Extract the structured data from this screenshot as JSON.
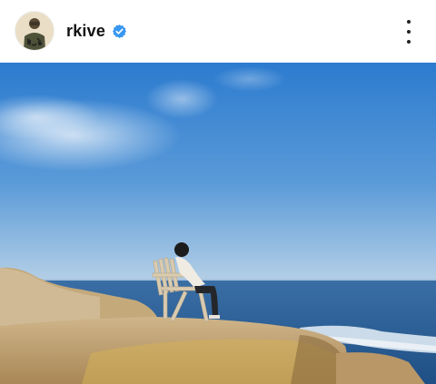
{
  "post": {
    "username": "rkive",
    "verified": true,
    "avatar_icon": "profile-avatar",
    "more_icon": "more-vertical-icon",
    "colors": {
      "verified_blue": "#3897f0",
      "sky_top": "#2f7fd0",
      "sky_horizon": "#a9c9e8",
      "sea": "#2f5f93",
      "rock": "#c9ad7e"
    }
  }
}
